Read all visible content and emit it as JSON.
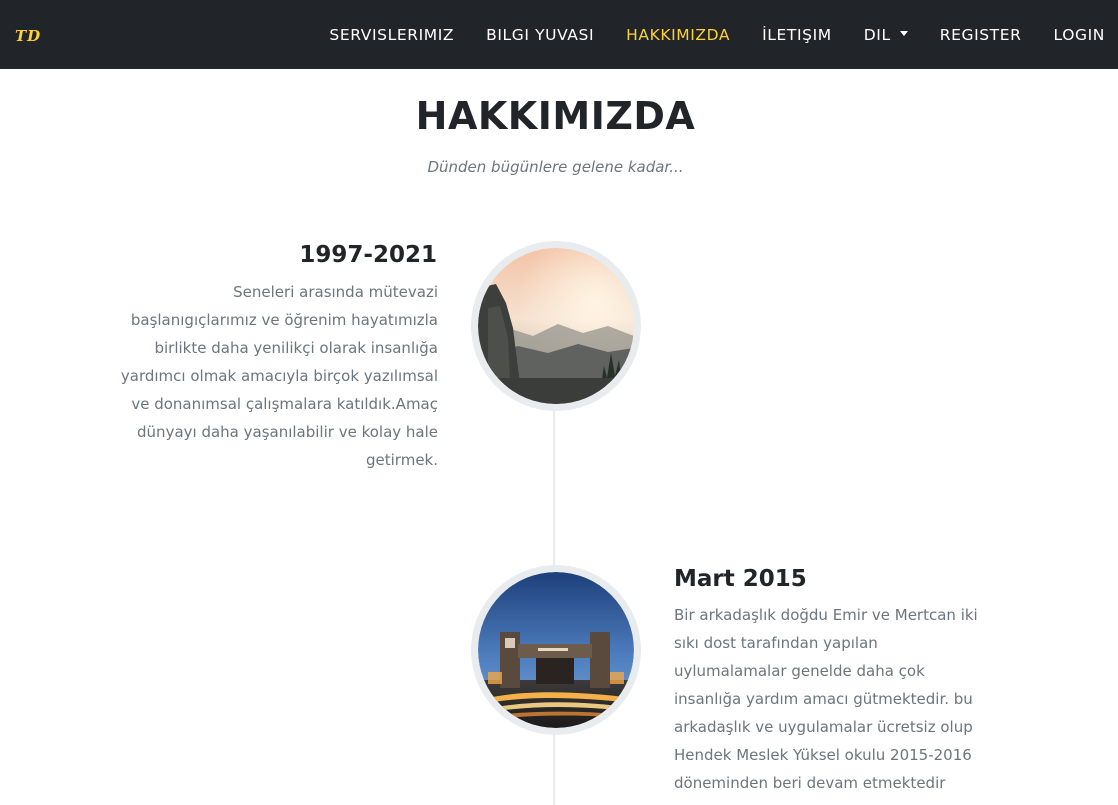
{
  "navbar": {
    "brand": "TD",
    "items": [
      {
        "label": "SERVISLERIMIZ",
        "active": false
      },
      {
        "label": "BILGI YUVASI",
        "active": false
      },
      {
        "label": "HAKKIMIZDA",
        "active": true
      },
      {
        "label": "İLETIŞIM",
        "active": false
      },
      {
        "label": "DIL",
        "active": false,
        "dropdown": true
      },
      {
        "label": "REGISTER",
        "active": false
      },
      {
        "label": "LOGIN",
        "active": false
      }
    ]
  },
  "about": {
    "heading": "HAKKIMIZDA",
    "subheading": "Dünden bügünlere gelene kadar..."
  },
  "timeline": [
    {
      "title": "1997-2021",
      "image": "mountain-valley-photo",
      "text": "Seneleri arasında mütevazi başlanıgıçlarımız ve öğrenim hayatımızla birlikte daha yenilikçi olarak insanlığa yardımcı olmak amacıyla birçok yazılımsal ve donanımsal çalışmalara katıldık.Amaç dünyayı daha yaşanılabilir ve kolay hale getirmek."
    },
    {
      "title": "Mart 2015",
      "image": "university-gate-photo",
      "text": "Bir arkadaşlık doğdu Emir ve Mertcan iki sıkı dost tarafından yapılan uylumalamalar genelde daha çok insanlığa yardım amacı gütmektedir. bu arkadaşlık ve uygulamalar ücretsiz olup Hendek Meslek Yüksel okulu 2015-2016 döneminden beri devam etmektedir"
    }
  ],
  "colors": {
    "navbar_bg": "#212529",
    "accent": "#fed136",
    "heading": "#212529",
    "muted_text": "#6c757d",
    "timeline_line": "#e9ecef"
  }
}
